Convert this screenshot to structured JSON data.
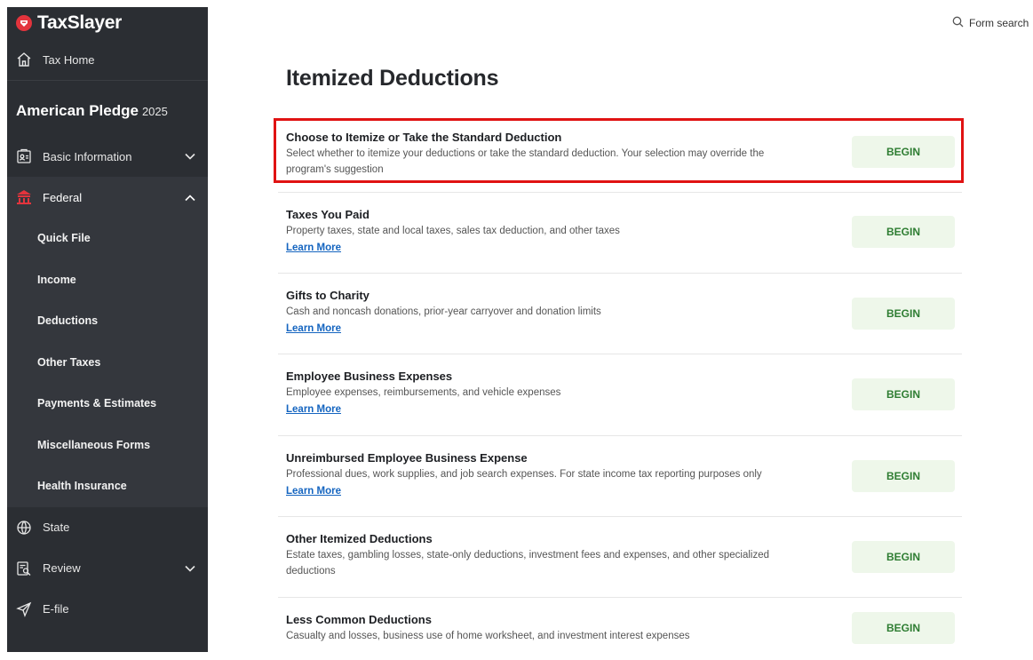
{
  "brand": {
    "name": "TaxSlayer"
  },
  "sidebar": {
    "tax_home": "Tax Home",
    "return_title": "American Pledge",
    "return_year": "2025",
    "sections": {
      "basic_information": "Basic Information",
      "federal": "Federal",
      "state": "State",
      "review": "Review",
      "efile": "E-file"
    },
    "federal_items": [
      "Quick File",
      "Income",
      "Deductions",
      "Other Taxes",
      "Payments & Estimates",
      "Miscellaneous Forms",
      "Health Insurance"
    ]
  },
  "topbar": {
    "search_label": "Form search"
  },
  "main": {
    "title": "Itemized Deductions",
    "button_label": "BEGIN",
    "link_label": "Learn More",
    "rows": [
      {
        "title": "Choose to Itemize or Take the Standard Deduction",
        "description": "Select whether to itemize your deductions or take the standard deduction. Your selection may override the program's suggestion"
      },
      {
        "title": "Taxes You Paid",
        "description": "Property taxes, state and local taxes, sales tax deduction, and other taxes"
      },
      {
        "title": "Gifts to Charity",
        "description": "Cash and noncash donations, prior-year carryover and donation limits"
      },
      {
        "title": "Employee Business Expenses",
        "description": "Employee expenses, reimbursements, and vehicle expenses"
      },
      {
        "title": "Unreimbursed Employee Business Expense",
        "description": "Professional dues, work supplies, and job search expenses. For state income tax reporting purposes only"
      },
      {
        "title": "Other Itemized Deductions",
        "description": "Estate taxes, gambling losses, state-only deductions, investment fees and expenses, and other specialized deductions"
      },
      {
        "title": "Less Common Deductions",
        "description": "Casualty and losses, business use of home worksheet, and investment interest expenses"
      }
    ]
  },
  "colors": {
    "sidebar_bg": "#2b2e33",
    "brand_red": "#e3343d",
    "begin_bg": "#eef7ea",
    "begin_text": "#2e7d32",
    "link": "#1565c0",
    "highlight": "#e01313"
  }
}
